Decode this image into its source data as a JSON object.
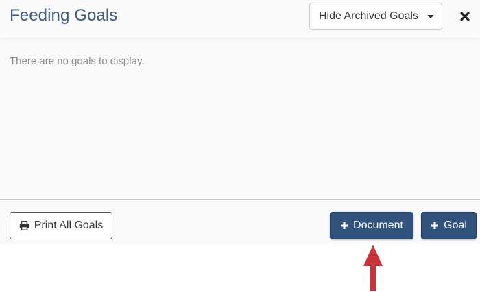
{
  "header": {
    "title": "Feeding Goals",
    "archive_filter": {
      "selected": "Hide Archived Goals"
    },
    "close_icon": "close-icon"
  },
  "body": {
    "empty_message": "There are no goals to display."
  },
  "footer": {
    "print_label": "Print All Goals",
    "print_icon": "printer-icon",
    "document_label": "Document",
    "goal_label": "Goal",
    "plus_icon": "plus-icon"
  },
  "colors": {
    "title": "#3b5a7f",
    "primary": "#30527c",
    "annotation_arrow": "#c8343a",
    "panel_bg": "#fafafa"
  }
}
